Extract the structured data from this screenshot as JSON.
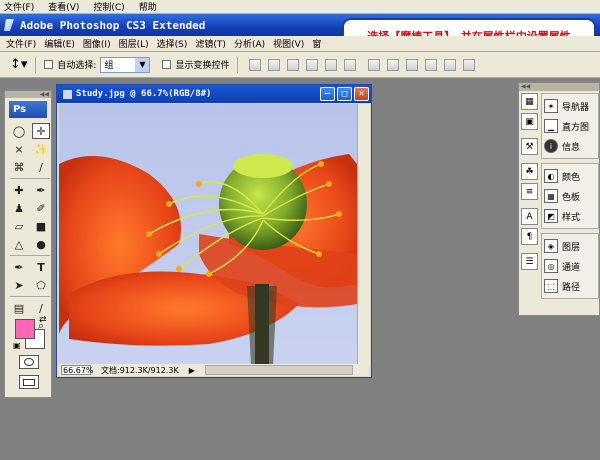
{
  "top_menu": [
    "文件(F)",
    "查看(V)",
    "控制(C)",
    "帮助"
  ],
  "window_title": "Adobe Photoshop CS3 Extended",
  "callout": "选择【魔棒工具】，并在属性栏中设置属性",
  "app_menu": [
    "文件(F)",
    "编辑(E)",
    "图像(I)",
    "图层(L)",
    "选择(S)",
    "滤镜(T)",
    "分析(A)",
    "视图(V)",
    "窗"
  ],
  "options": {
    "auto_select_label": "自动选择:",
    "auto_select_value": "组",
    "show_transform_label": "显示变换控件"
  },
  "toolbox": {
    "logo": "Ps"
  },
  "document": {
    "title": "Study.jpg @ 66.7%(RGB/8#)",
    "zoom": "66.67%",
    "doc_info": "文档:912.3K/912.3K"
  },
  "panels": {
    "group1": [
      "导航器",
      "直方图",
      "信息"
    ],
    "group2": [
      "颜色",
      "色板",
      "样式"
    ],
    "group3": [
      "图层",
      "通道",
      "路径"
    ]
  },
  "colors": {
    "foreground": "#ff66b4",
    "background": "#ffffff"
  }
}
